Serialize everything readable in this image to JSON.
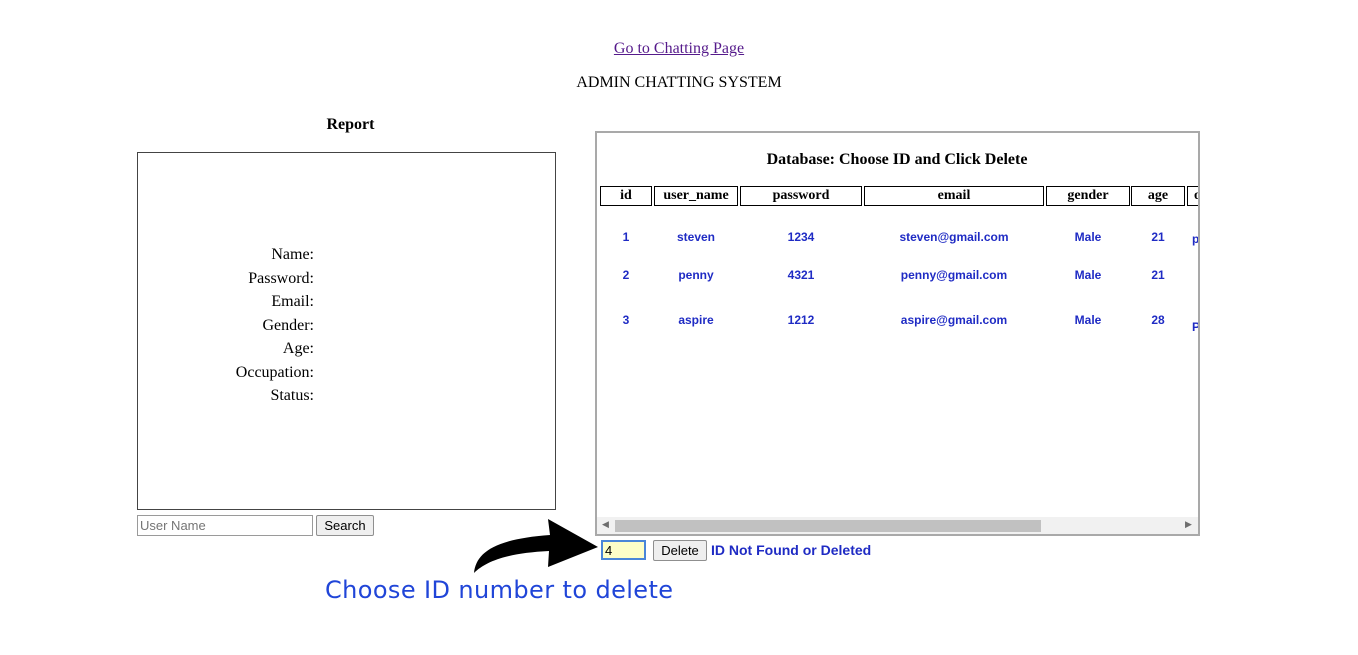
{
  "nav": {
    "chat_link": "Go to Chatting Page"
  },
  "app_title": "ADMIN CHATTING SYSTEM",
  "report": {
    "title": "Report",
    "fields": [
      "Name:",
      "Password:",
      "Email:",
      "Gender:",
      "Age:",
      "Occupation:",
      "Status:"
    ]
  },
  "search": {
    "placeholder": "User Name",
    "button_label": "Search"
  },
  "database": {
    "title": "Database: Choose ID and Click Delete",
    "columns": [
      "id",
      "user_name",
      "password",
      "email",
      "gender",
      "age",
      "o"
    ],
    "rows": [
      {
        "id": "1",
        "user_name": "steven",
        "password": "1234",
        "email": "steven@gmail.com",
        "gender": "Male",
        "age": "21",
        "occupation": "p"
      },
      {
        "id": "2",
        "user_name": "penny",
        "password": "4321",
        "email": "penny@gmail.com",
        "gender": "Male",
        "age": "21",
        "occupation": ""
      },
      {
        "id": "3",
        "user_name": "aspire",
        "password": "1212",
        "email": "aspire@gmail.com",
        "gender": "Male",
        "age": "28",
        "occupation": "P"
      }
    ],
    "scroll_left_icon": "◀",
    "scroll_right_icon": "▶"
  },
  "delete": {
    "id_value": "4",
    "button_label": "Delete",
    "status": "ID Not Found or Deleted"
  },
  "annotation": {
    "caption": "Choose ID number to delete",
    "arrow_icon": "curved-arrow-icon"
  },
  "colors": {
    "link": "#551a8b",
    "data_text": "#1f2bc4",
    "caption": "#2045d8",
    "input_highlight": "#fdfec8"
  }
}
